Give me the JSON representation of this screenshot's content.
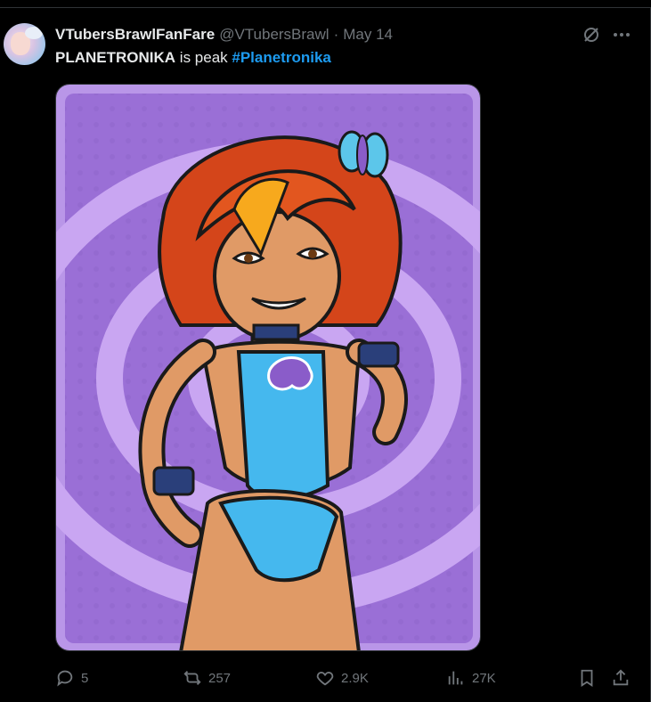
{
  "post": {
    "display_name": "VTubersBrawlFanFare",
    "handle": "@VTubersBrawl",
    "separator": "·",
    "date": "May 14",
    "text_bold": "PLANETRONIKA",
    "text_plain": " is peak ",
    "hashtag": "#Planetronika"
  },
  "media": {
    "alt": "Cartoon illustration of an orange-haired girl in a blue outfit with a butterfly hair clip on a purple spiral background"
  },
  "actions": {
    "replies": "5",
    "reposts": "257",
    "likes": "2.9K",
    "views": "27K"
  },
  "icons": {
    "grok": "grok-icon",
    "more": "more-icon",
    "reply": "reply-icon",
    "repost": "repost-icon",
    "like": "heart-icon",
    "views": "analytics-icon",
    "bookmark": "bookmark-icon",
    "share": "share-icon"
  },
  "colors": {
    "background": "#000000",
    "text": "#e7e9ea",
    "muted": "#71767b",
    "link": "#1d9bf0",
    "media_bg": "#a77fd8"
  }
}
